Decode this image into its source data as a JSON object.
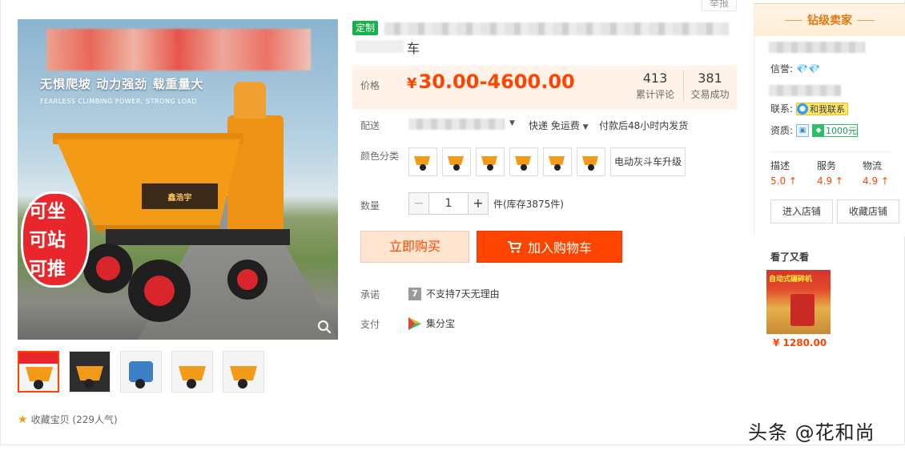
{
  "gallery": {
    "slogan": "无惧爬坡 动力强劲 载重量大",
    "slogan_en": "FEARLESS CLIMBING POWER, STRONG LOAD",
    "brand_plate": "鑫浩宇",
    "red_badge": [
      "可坐",
      "可站",
      "可推"
    ],
    "thumbnail_count": 5,
    "favorite_label": "收藏宝贝 (229人气)"
  },
  "product": {
    "report_label": "举报",
    "custom_tag": "定制",
    "title_tail": "车",
    "price_label": "价格",
    "price_currency": "¥",
    "price_range": "30.00-4600.00",
    "reviews_count": "413",
    "reviews_label": "累计评论",
    "sales_count": "381",
    "sales_label": "交易成功",
    "shipping_label": "配送",
    "shipping_fee": "快递 免运费",
    "shipping_time": "付款后48小时内发货",
    "color_label": "颜色分类",
    "color_text_option": "电动灰斗车升级",
    "color_image_option_count": 6,
    "qty_label": "数量",
    "qty_value": "1",
    "qty_minus": "−",
    "qty_plus": "+",
    "qty_stock": "件(库存3875件)",
    "buy_now_label": "立即购买",
    "add_cart_label": "加入购物车",
    "promise_label": "承诺",
    "promise_icon_text": "7",
    "promise_text": "不支持7天无理由",
    "pay_label": "支付",
    "pay_text": "集分宝"
  },
  "seller": {
    "level_title": "钻级卖家",
    "credit_label": "信誉:",
    "credit_icon": "💎💎",
    "contact_label": "联系:",
    "contact_button": "和我联系",
    "qualification_label": "资质:",
    "deposit_text": "1000元",
    "scores": [
      {
        "name": "描述",
        "value": "5.0",
        "arrow": "↑"
      },
      {
        "name": "服务",
        "value": "4.9",
        "arrow": "↑"
      },
      {
        "name": "物流",
        "value": "4.9",
        "arrow": "↑"
      }
    ],
    "enter_shop_label": "进入店铺",
    "favorite_shop_label": "收藏店铺"
  },
  "recommend": {
    "title": "看了又看",
    "banner_text": "自动式碾碎机",
    "price": "¥ 1280.00"
  },
  "watermark": "头条 @花和尚",
  "colors": {
    "accent": "#ff4400",
    "price_bg": "#fff2e8",
    "buy_bg": "#ffe4d0",
    "custom_tag": "#17b04a",
    "seller_head": "#e07a14"
  }
}
